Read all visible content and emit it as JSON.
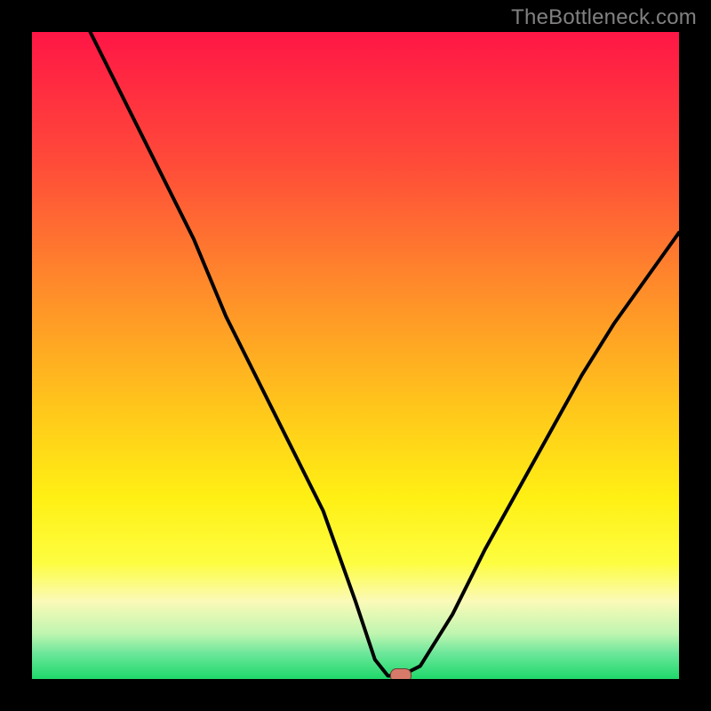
{
  "watermark": "TheBottleneck.com",
  "chart_data": {
    "type": "line",
    "title": "",
    "xlabel": "",
    "ylabel": "",
    "xlim": [
      0,
      100
    ],
    "ylim": [
      0,
      100
    ],
    "grid": false,
    "legend_position": "none",
    "series": [
      {
        "name": "bottleneck-curve",
        "color": "#000000",
        "x": [
          9,
          15,
          20,
          25,
          30,
          35,
          40,
          45,
          50,
          53,
          55,
          57,
          60,
          65,
          70,
          75,
          80,
          85,
          90,
          95,
          100
        ],
        "y": [
          100,
          88,
          78,
          68,
          56,
          46,
          36,
          26,
          12,
          3,
          0.5,
          0.5,
          2,
          10,
          20,
          29,
          38,
          47,
          55,
          62,
          69
        ]
      }
    ],
    "marker": {
      "name": "selected-point",
      "x": 57,
      "y": 0.6,
      "color": "#d87a6a"
    },
    "background_gradient": {
      "orientation": "vertical",
      "stops": [
        {
          "pos": 0.0,
          "color": "#ff1646"
        },
        {
          "pos": 0.2,
          "color": "#ff4a39"
        },
        {
          "pos": 0.4,
          "color": "#ff8d2a"
        },
        {
          "pos": 0.58,
          "color": "#ffc61b"
        },
        {
          "pos": 0.72,
          "color": "#fff014"
        },
        {
          "pos": 0.82,
          "color": "#fdfd40"
        },
        {
          "pos": 0.88,
          "color": "#fbfab8"
        },
        {
          "pos": 0.93,
          "color": "#bff5b0"
        },
        {
          "pos": 0.96,
          "color": "#6de79b"
        },
        {
          "pos": 1.0,
          "color": "#1ed86a"
        }
      ]
    }
  }
}
